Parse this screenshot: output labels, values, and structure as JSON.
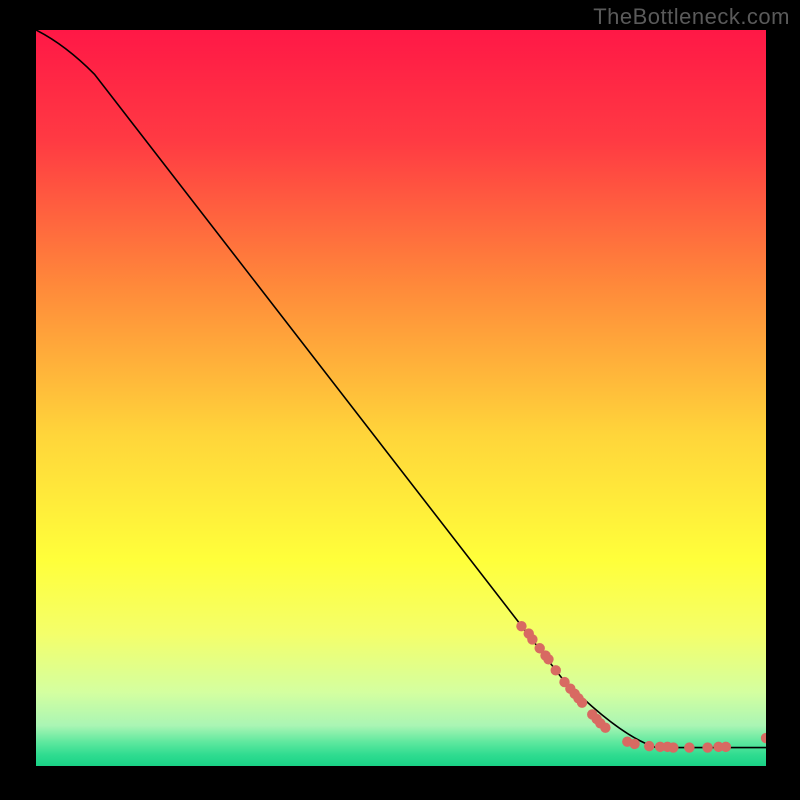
{
  "watermark": "TheBottleneck.com",
  "chart_data": {
    "type": "line",
    "title": "",
    "xlabel": "",
    "ylabel": "",
    "xlim": [
      0,
      100
    ],
    "ylim": [
      0,
      100
    ],
    "grid": false,
    "series": [
      {
        "name": "curve",
        "style": "line-black",
        "points": [
          {
            "x": 0,
            "y": 100
          },
          {
            "x": 4,
            "y": 98
          },
          {
            "x": 8,
            "y": 94
          },
          {
            "x": 72,
            "y": 12
          },
          {
            "x": 80,
            "y": 4
          },
          {
            "x": 85,
            "y": 2.5
          },
          {
            "x": 100,
            "y": 2.5
          }
        ]
      },
      {
        "name": "overlay-markers",
        "style": "dots-salmon",
        "points": [
          {
            "x": 66.5,
            "y": 19.0
          },
          {
            "x": 67.5,
            "y": 18.0
          },
          {
            "x": 68.0,
            "y": 17.2
          },
          {
            "x": 69.0,
            "y": 16.0
          },
          {
            "x": 69.8,
            "y": 15.0
          },
          {
            "x": 70.2,
            "y": 14.5
          },
          {
            "x": 71.2,
            "y": 13.0
          },
          {
            "x": 72.4,
            "y": 11.4
          },
          {
            "x": 73.2,
            "y": 10.5
          },
          {
            "x": 73.8,
            "y": 9.8
          },
          {
            "x": 74.3,
            "y": 9.2
          },
          {
            "x": 74.8,
            "y": 8.6
          },
          {
            "x": 76.2,
            "y": 7.0
          },
          {
            "x": 76.8,
            "y": 6.4
          },
          {
            "x": 77.3,
            "y": 5.8
          },
          {
            "x": 78.0,
            "y": 5.2
          },
          {
            "x": 81.0,
            "y": 3.3
          },
          {
            "x": 82.0,
            "y": 3.0
          },
          {
            "x": 84.0,
            "y": 2.7
          },
          {
            "x": 85.5,
            "y": 2.6
          },
          {
            "x": 86.5,
            "y": 2.6
          },
          {
            "x": 87.3,
            "y": 2.5
          },
          {
            "x": 89.5,
            "y": 2.5
          },
          {
            "x": 92.0,
            "y": 2.5
          },
          {
            "x": 93.5,
            "y": 2.6
          },
          {
            "x": 94.5,
            "y": 2.6
          },
          {
            "x": 100.0,
            "y": 3.8
          }
        ]
      }
    ],
    "background_gradient": {
      "direction": "vertical",
      "stops": [
        {
          "pos": 0.0,
          "color": "#ff1846"
        },
        {
          "pos": 0.15,
          "color": "#ff3a43"
        },
        {
          "pos": 0.35,
          "color": "#ff8a3a"
        },
        {
          "pos": 0.55,
          "color": "#ffd53a"
        },
        {
          "pos": 0.72,
          "color": "#ffff3a"
        },
        {
          "pos": 0.82,
          "color": "#f4ff6a"
        },
        {
          "pos": 0.9,
          "color": "#d4ffa0"
        },
        {
          "pos": 0.945,
          "color": "#aaf5b4"
        },
        {
          "pos": 0.968,
          "color": "#5de89e"
        },
        {
          "pos": 0.985,
          "color": "#2fdc90"
        },
        {
          "pos": 1.0,
          "color": "#19d286"
        }
      ]
    }
  }
}
